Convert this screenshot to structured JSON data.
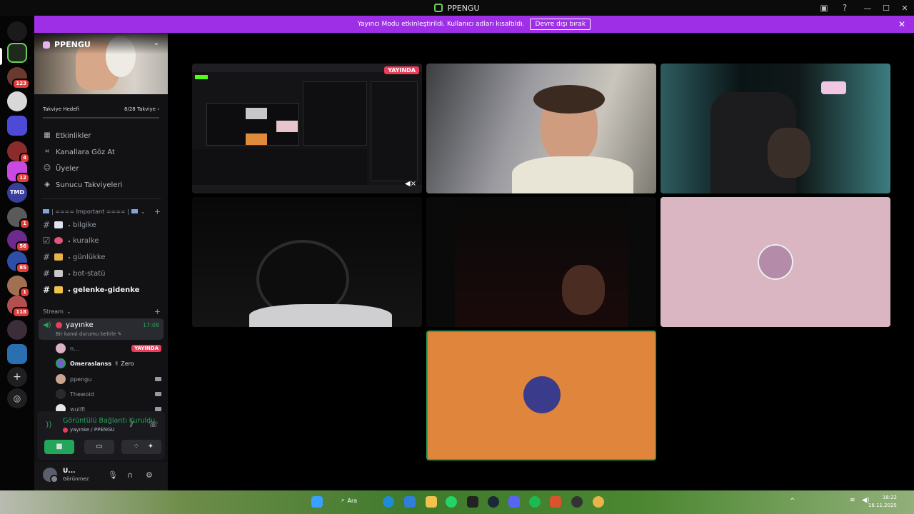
{
  "window": {
    "title": "PPENGU"
  },
  "notice": {
    "text": "Yayıncı Modu etkinleştirildi. Kullanıcı adları kısaltıldı.",
    "button": "Devre dışı bırak"
  },
  "server_rail": {
    "badges": [
      "123",
      "4",
      "12",
      "1",
      "56",
      "85",
      "1",
      "118"
    ],
    "tmd_label": "TMD"
  },
  "server": {
    "name": "PPENGU",
    "boost_goal_label": "Takviye Hedefi",
    "boost_count": "8/28 Takviye",
    "menu": [
      "Etkinlikler",
      "Kanallara Göz At",
      "Üyeler",
      "Sunucu Takviyeleri"
    ]
  },
  "categories": {
    "important": "==== Important ====",
    "stream": "Stream"
  },
  "channels": [
    {
      "name": "bilgike"
    },
    {
      "name": "kuralke"
    },
    {
      "name": "günlükke"
    },
    {
      "name": "bot-statü"
    },
    {
      "name": "gelenke-gidenke"
    }
  ],
  "voice_channel": {
    "name": "yayınke",
    "time": "17:08",
    "status": "Bir kanal durumu belirle"
  },
  "members": [
    {
      "name": "n...",
      "live": "YAYINDA"
    },
    {
      "name": "Omeraslanss",
      "tag": "Zero"
    },
    {
      "name": "ppengu"
    },
    {
      "name": "Thewoid"
    },
    {
      "name": "wullfi"
    }
  ],
  "voice_panel": {
    "status": "Görüntülü Bağlantı Kuruldu",
    "channel": "yayınke / PPENGU"
  },
  "user": {
    "name": "U...",
    "status": "Görünmez"
  },
  "stage": {
    "live_badge": "YAYINDA"
  },
  "taskbar": {
    "search": "Ara",
    "time": "18:22",
    "date": "16.11.2025"
  }
}
